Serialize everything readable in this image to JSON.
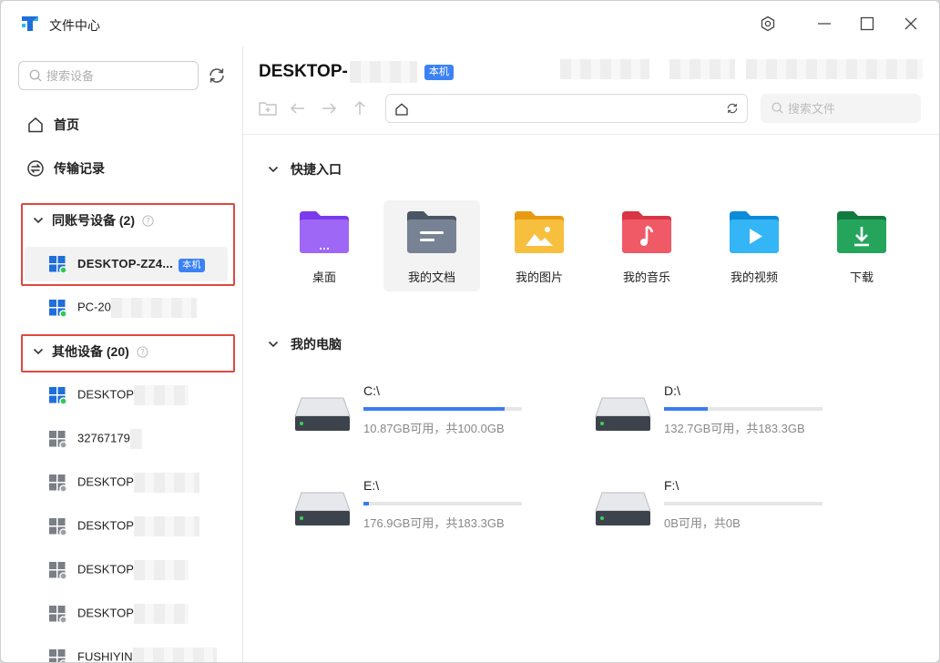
{
  "window": {
    "title": "文件中心"
  },
  "sidebar": {
    "search_placeholder": "搜索设备",
    "nav": [
      {
        "label": "首页",
        "icon": "home-icon"
      },
      {
        "label": "传输记录",
        "icon": "transfer-icon"
      }
    ],
    "groups": [
      {
        "title": "同账号设备 (2)",
        "devices": [
          {
            "name": "DESKTOP-ZZ4...",
            "badge": "本机",
            "status": "online",
            "selected": true
          },
          {
            "name": "PC-20",
            "status": "online"
          }
        ]
      },
      {
        "title": "其他设备 (20)",
        "devices": [
          {
            "name": "DESKTOP",
            "status": "online"
          },
          {
            "name": "32767179",
            "status": "offline"
          },
          {
            "name": "DESKTOP",
            "status": "offline"
          },
          {
            "name": "DESKTOP",
            "status": "offline"
          },
          {
            "name": "DESKTOP",
            "status": "offline"
          },
          {
            "name": "DESKTOP",
            "status": "offline"
          },
          {
            "name": "FUSHIYIN",
            "status": "offline"
          }
        ]
      }
    ]
  },
  "main": {
    "device_title": "DESKTOP-",
    "device_badge": "本机",
    "path_value": "",
    "file_search_placeholder": "搜索文件",
    "quick_access": {
      "title": "快捷入口",
      "items": [
        {
          "label": "桌面",
          "icon": "desktop-folder-icon",
          "color": "#8b5cf6"
        },
        {
          "label": "我的文档",
          "icon": "documents-folder-icon",
          "color": "#64748b"
        },
        {
          "label": "我的图片",
          "icon": "pictures-folder-icon",
          "color": "#f5b731"
        },
        {
          "label": "我的音乐",
          "icon": "music-folder-icon",
          "color": "#ef4b55"
        },
        {
          "label": "我的视频",
          "icon": "videos-folder-icon",
          "color": "#22a7f0"
        },
        {
          "label": "下载",
          "icon": "downloads-folder-icon",
          "color": "#1f9d55"
        }
      ]
    },
    "my_computer": {
      "title": "我的电脑",
      "drives": [
        {
          "name": "C:\\",
          "info": "10.87GB可用，共100.0GB",
          "used_fraction": 0.891
        },
        {
          "name": "D:\\",
          "info": "132.7GB可用，共183.3GB",
          "used_fraction": 0.276
        },
        {
          "name": "E:\\",
          "info": "176.9GB可用，共183.3GB",
          "used_fraction": 0.035
        },
        {
          "name": "F:\\",
          "info": "0B可用，共0B",
          "used_fraction": 0
        }
      ]
    }
  },
  "colors": {
    "accent": "#3b82f6",
    "highlight_box": "#e0483e",
    "online": "#34c759",
    "offline": "#9aa0a6"
  }
}
